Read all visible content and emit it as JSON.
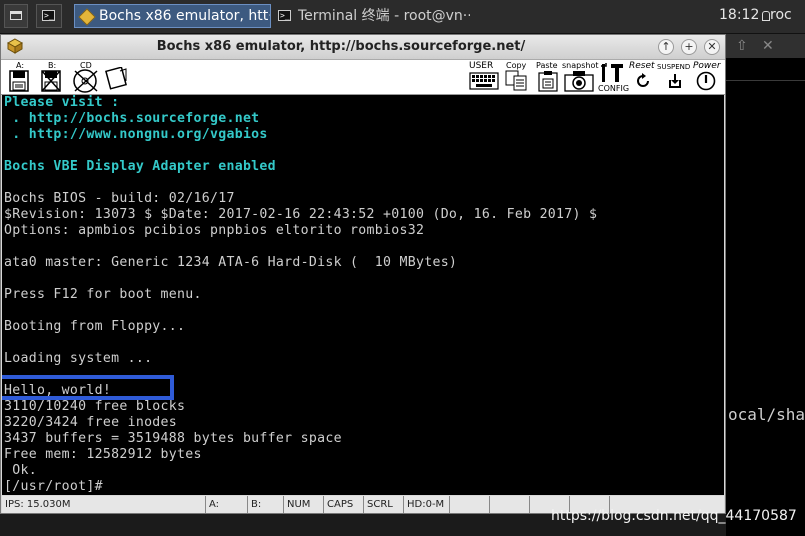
{
  "taskbar": {
    "bochs_task": "Bochs x86 emulator, htt···",
    "terminal_task": "Terminal 终端 - root@vn···",
    "clock": "18:12",
    "user": "roc"
  },
  "background_terminal": {
    "visible_text": "ocal/sha",
    "max_glyph": "⇧",
    "close_glyph": "✕"
  },
  "bochs": {
    "title": "Bochs x86 emulator, http://bochs.sourceforge.net/",
    "window_buttons": {
      "up": "↑",
      "max": "+",
      "close": "✕"
    },
    "toolbar": {
      "floppy_a": "A:",
      "floppy_b": "B:",
      "cdrom": "CD",
      "user": "USER",
      "copy": "Copy",
      "paste": "Paste",
      "snapshot": "snapshot",
      "config": "CONFIG",
      "reset": "Reset",
      "suspend": "SUSPEND",
      "power": "Power"
    },
    "console_lines": [
      {
        "text": "Please visit :",
        "style": "cyan"
      },
      {
        "text": " . http://bochs.sourceforge.net",
        "style": "cyan"
      },
      {
        "text": " . http://www.nongnu.org/vgabios",
        "style": "cyan"
      },
      {
        "text": "",
        "style": "gray"
      },
      {
        "text": "Bochs VBE Display Adapter enabled",
        "style": "cyan"
      },
      {
        "text": "",
        "style": "gray"
      },
      {
        "text": "Bochs BIOS - build: 02/16/17",
        "style": "gray"
      },
      {
        "text": "$Revision: 13073 $ $Date: 2017-02-16 22:43:52 +0100 (Do, 16. Feb 2017) $",
        "style": "gray"
      },
      {
        "text": "Options: apmbios pcibios pnpbios eltorito rombios32",
        "style": "gray"
      },
      {
        "text": "",
        "style": "gray"
      },
      {
        "text": "ata0 master: Generic 1234 ATA-6 Hard-Disk (  10 MBytes)",
        "style": "gray"
      },
      {
        "text": "",
        "style": "gray"
      },
      {
        "text": "Press F12 for boot menu.",
        "style": "gray"
      },
      {
        "text": "",
        "style": "gray"
      },
      {
        "text": "Booting from Floppy...",
        "style": "gray"
      },
      {
        "text": "",
        "style": "gray"
      },
      {
        "text": "Loading system ...",
        "style": "gray"
      },
      {
        "text": "",
        "style": "gray"
      },
      {
        "text": "Hello, world!",
        "style": "gray"
      },
      {
        "text": "3110/10240 free blocks",
        "style": "gray"
      },
      {
        "text": "3220/3424 free inodes",
        "style": "gray"
      },
      {
        "text": "3437 buffers = 3519488 bytes buffer space",
        "style": "gray"
      },
      {
        "text": "Free mem: 12582912 bytes",
        "style": "gray"
      },
      {
        "text": " Ok.",
        "style": "gray"
      },
      {
        "text": "[/usr/root]#",
        "style": "gray"
      }
    ],
    "statusbar": {
      "ips": "IPS: 15.030M",
      "a": "A:",
      "b": "B:",
      "num": "NUM",
      "caps": "CAPS",
      "scrl": "SCRL",
      "hd": "HD:0-M"
    }
  },
  "watermark": "https://blog.csdn.net/qq_44170587",
  "colors": {
    "console_bg": "#000000",
    "console_cyan": "#34c9c9",
    "console_text": "#cfcfcf",
    "highlight_box": "#2f5bd8",
    "taskbar_active": "#3d5a80"
  }
}
